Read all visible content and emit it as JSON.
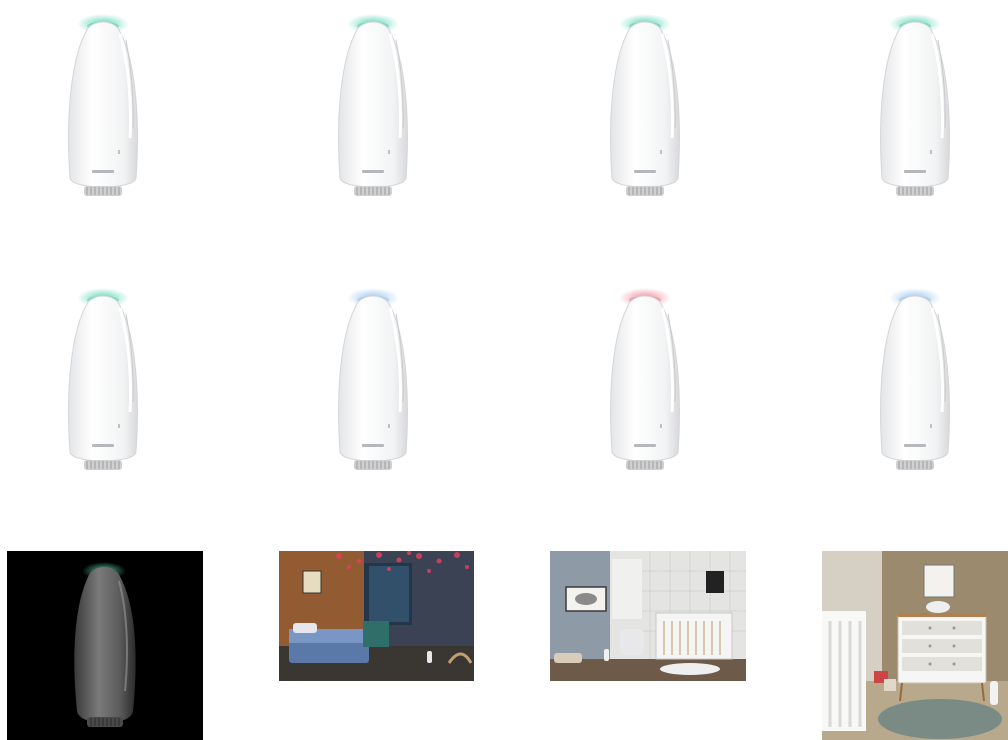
{
  "gallery": {
    "products": [
      {
        "name": "purifier-1",
        "glow": "#5fd6b4"
      },
      {
        "name": "purifier-2",
        "glow": "#5fd6b4"
      },
      {
        "name": "purifier-3",
        "glow": "#5fd6b4"
      },
      {
        "name": "purifier-4",
        "glow": "#5fd6b4"
      },
      {
        "name": "purifier-5",
        "glow": "#5fd6b4"
      },
      {
        "name": "purifier-6",
        "glow": "#9cc6ee"
      },
      {
        "name": "purifier-7",
        "glow": "#ee8a9a"
      },
      {
        "name": "purifier-8",
        "glow": "#9cc6ee"
      }
    ],
    "scenes": [
      {
        "name": "dark-product",
        "background": "#000000",
        "glow": "#5fd6b4"
      },
      {
        "name": "night-bedroom",
        "projection": "#e0405a"
      },
      {
        "name": "nursery-grey"
      },
      {
        "name": "nursery-wood"
      }
    ]
  }
}
